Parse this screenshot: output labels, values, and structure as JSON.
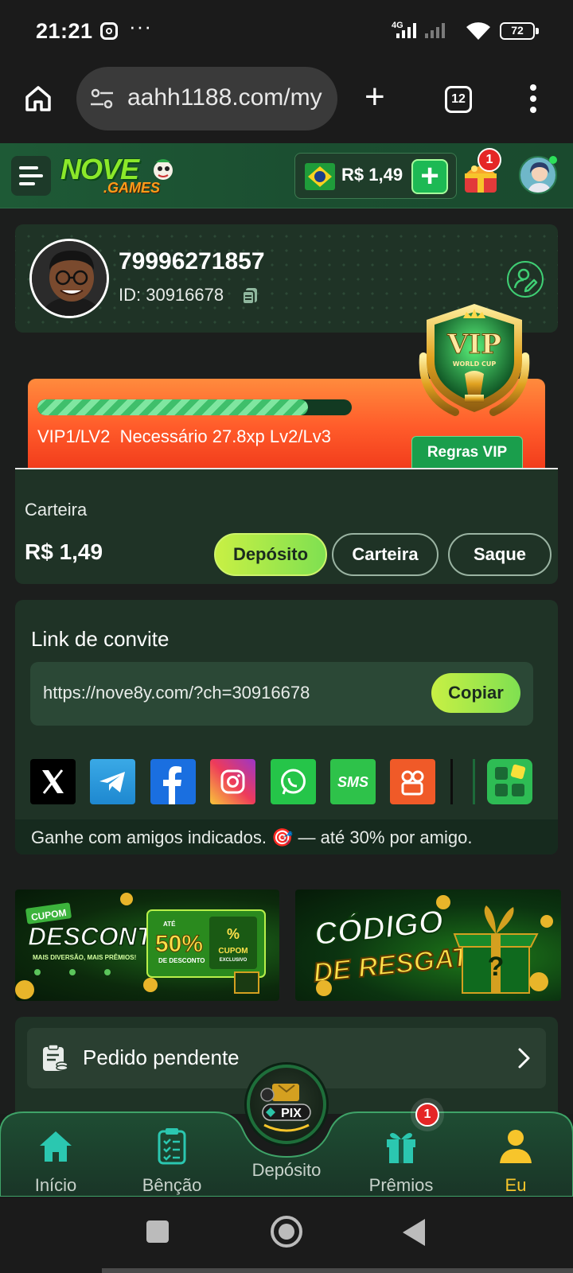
{
  "status_bar": {
    "time": "21:21",
    "dots": "···",
    "network": "4G",
    "battery": "72"
  },
  "browser": {
    "url": "aahh1188.com/my",
    "tab_count": "12"
  },
  "header": {
    "logo_main": "NOVE",
    "logo_sub": ".GAMES",
    "balance": "R$ 1,49",
    "rewards_badge": "1"
  },
  "profile": {
    "username": "79996271857",
    "id_text": "ID: 30916678"
  },
  "vip": {
    "progress": 0.86,
    "level": "VIP1/LV2",
    "requirement": "Necessário 27.8xp Lv2/Lv3",
    "rules_label": "Regras VIP",
    "badge_title": "VIP",
    "badge_sub": "WORLD CUP"
  },
  "wallet": {
    "label": "Carteira",
    "amount": "R$ 1,49",
    "deposit_label": "Depósito",
    "wallet_label": "Carteira",
    "withdraw_label": "Saque"
  },
  "invite": {
    "title": "Link de convite",
    "link": "https://nove8y.com/?ch=30916678",
    "copy_label": "Copiar",
    "sms_label": "SMS",
    "footer": "Ganhe com amigos indicados. 🎯 — até 30% por amigo."
  },
  "banners": {
    "coupon": {
      "tag": "CUPOM",
      "title": "DESCONTO",
      "subtitle": "MAIS DIVERSÃO, MAIS PRÊMIOS!",
      "percent": "50%",
      "up_to": "ATÉ",
      "discount_label": "DE DESCONTO",
      "coupon_label": "CUPOM",
      "exclusive_label": "EXCLUSIVO",
      "percent_sign": "%"
    },
    "redeem": {
      "line1": "CÓDIGO",
      "line2": "DE RESGATE"
    }
  },
  "pending": {
    "label": "Pedido pendente"
  },
  "bottom_nav": {
    "items": [
      {
        "label": "Início"
      },
      {
        "label": "Bênção"
      },
      {
        "label": "Depósito"
      },
      {
        "label": "Prêmios"
      },
      {
        "label": "Eu"
      }
    ],
    "pix_label": "PIX",
    "prizes_badge": "1"
  },
  "colors": {
    "accent_green": "#1db954",
    "gold": "#f7c52b",
    "card_bg": "#1f3326",
    "vip_orange": "#ff6a2e"
  }
}
